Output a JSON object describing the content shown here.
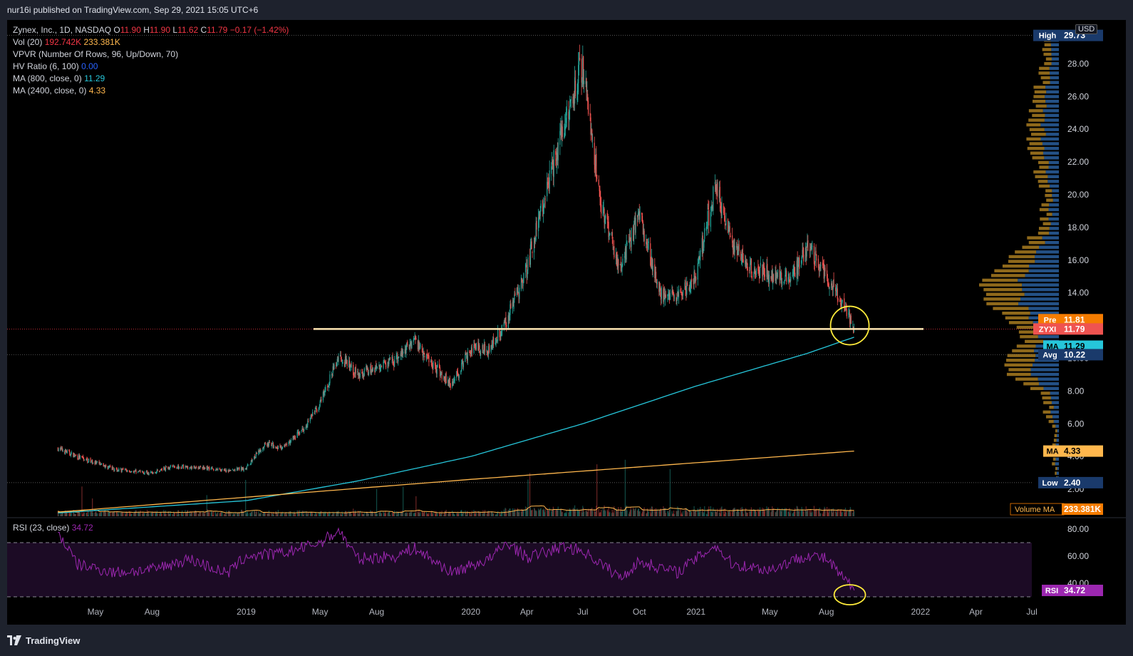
{
  "header": {
    "published": "nur16i published on TradingView.com, Sep 29, 2021 15:05 UTC+6"
  },
  "footer": {
    "brand": "TradingView"
  },
  "legend": {
    "symbol": "Zynex, Inc., 1D, NASDAQ",
    "o_label": "O",
    "o": "11.90",
    "h_label": "H",
    "h": "11.90",
    "l_label": "L",
    "l": "11.62",
    "c_label": "C",
    "c": "11.79",
    "change": "−0.17 (−1.42%)",
    "vol_label": "Vol (20)",
    "vol1": "192.742K",
    "vol2": "233.381K",
    "vpvr": "VPVR (Number Of Rows, 96, Up/Down, 70)",
    "hv_label": "HV Ratio (6, 100)",
    "hv": "0.00",
    "ma800_label": "MA (800, close, 0)",
    "ma800": "11.29",
    "ma2400_label": "MA (2400, close, 0)",
    "ma2400": "4.33"
  },
  "rsi_legend": {
    "label": "RSI (23, close)",
    "value": "34.72"
  },
  "currency": "USD",
  "colors": {
    "up": "#26a69a",
    "down": "#ef5350",
    "ma800": "#26c6da",
    "ma2400": "#ffb74d",
    "rsi": "#9c27b0",
    "support": "#ffe6b3",
    "circle": "#ffeb3b",
    "vpvr_up": "#2a5f9e",
    "vpvr_down": "#a87b20"
  },
  "chart_data": [
    {
      "type": "candlestick",
      "title": "Zynex, Inc., 1D, NASDAQ",
      "xlabel": "",
      "ylabel": "",
      "ylim": [
        0.5,
        30.2
      ],
      "x_ticks": [
        "May",
        "Aug",
        "2019",
        "May",
        "Aug",
        "2020",
        "Apr",
        "Jul",
        "Oct",
        "2021",
        "May",
        "Aug",
        "2022",
        "Apr",
        "Jul"
      ],
      "y_ticks": [
        2,
        4,
        6,
        8,
        10,
        12,
        14,
        16,
        18,
        20,
        22,
        24,
        26,
        28
      ],
      "y_tick_labels": [
        "2.00",
        "4.00",
        "6.00",
        "8.00",
        "10.00",
        "12.00",
        "14.00",
        "16.00",
        "18.00",
        "20.00",
        "22.00",
        "24.00",
        "26.00",
        "28.00"
      ],
      "price_path": [
        {
          "x": "Mar 2018",
          "y": 4.5
        },
        {
          "x": "Apr 2018",
          "y": 4.0
        },
        {
          "x": "May 2018",
          "y": 3.6
        },
        {
          "x": "Jun 2018",
          "y": 3.2
        },
        {
          "x": "Aug 2018",
          "y": 3.0
        },
        {
          "x": "Sep 2018",
          "y": 3.4
        },
        {
          "x": "Nov 2018",
          "y": 3.3
        },
        {
          "x": "Dec 2018",
          "y": 3.1
        },
        {
          "x": "Jan 2019",
          "y": 3.3
        },
        {
          "x": "Feb 2019",
          "y": 4.8
        },
        {
          "x": "Mar 2019",
          "y": 4.5
        },
        {
          "x": "Apr 2019",
          "y": 5.6
        },
        {
          "x": "May 2019",
          "y": 7.2
        },
        {
          "x": "Jun 2019",
          "y": 10.2
        },
        {
          "x": "Jul 2019",
          "y": 9.0
        },
        {
          "x": "Aug 2019",
          "y": 9.5
        },
        {
          "x": "Sep 2019",
          "y": 9.8
        },
        {
          "x": "Oct 2019",
          "y": 11.2
        },
        {
          "x": "Nov 2019",
          "y": 9.6
        },
        {
          "x": "Dec 2019",
          "y": 8.4
        },
        {
          "x": "Jan 2020",
          "y": 10.6
        },
        {
          "x": "Feb 2020",
          "y": 10.6
        },
        {
          "x": "Mar 2020",
          "y": 12.5
        },
        {
          "x": "Apr 2020",
          "y": 15.5
        },
        {
          "x": "May 2020",
          "y": 20.0
        },
        {
          "x": "Jun 2020",
          "y": 24.5
        },
        {
          "x": "Jul 2020",
          "y": 28.0
        },
        {
          "x": "Aug 2020",
          "y": 19.0
        },
        {
          "x": "Sep 2020",
          "y": 15.5
        },
        {
          "x": "Oct 2020",
          "y": 19.0
        },
        {
          "x": "Nov 2020",
          "y": 14.0
        },
        {
          "x": "Dec 2020",
          "y": 13.6
        },
        {
          "x": "Jan 2021",
          "y": 15.0
        },
        {
          "x": "Feb 2021",
          "y": 20.5
        },
        {
          "x": "Mar 2021",
          "y": 17.0
        },
        {
          "x": "Apr 2021",
          "y": 15.4
        },
        {
          "x": "May 2021",
          "y": 15.2
        },
        {
          "x": "Jun 2021",
          "y": 14.8
        },
        {
          "x": "Jul 2021",
          "y": 16.8
        },
        {
          "x": "Aug 2021",
          "y": 15.0
        },
        {
          "x": "Sep 2021",
          "y": 13.0
        },
        {
          "x": "Sep 29 2021",
          "y": 11.79
        }
      ],
      "last": {
        "open": 11.9,
        "high": 11.9,
        "low": 11.62,
        "close": 11.79,
        "change": -0.17,
        "change_pct": -1.42
      },
      "support_level": 11.79,
      "ma800": [
        {
          "x": "Mar 2018",
          "y": 0.55
        },
        {
          "x": "Jan 2019",
          "y": 1.3
        },
        {
          "x": "Jul 2019",
          "y": 2.5
        },
        {
          "x": "Jan 2020",
          "y": 4.0
        },
        {
          "x": "Jul 2020",
          "y": 6.0
        },
        {
          "x": "Jan 2021",
          "y": 8.3
        },
        {
          "x": "Jul 2021",
          "y": 10.3
        },
        {
          "x": "Sep 29 2021",
          "y": 11.29
        }
      ],
      "ma2400": [
        {
          "x": "Mar 2018",
          "y": 0.6
        },
        {
          "x": "Jan 2020",
          "y": 2.6
        },
        {
          "x": "Sep 29 2021",
          "y": 4.33
        }
      ],
      "price_labels": [
        {
          "label": "High",
          "value": "29.73"
        },
        {
          "label": "Pre",
          "value": "11.81"
        },
        {
          "label": "ZYXI",
          "value": "11.79"
        },
        {
          "label": "MA",
          "value": "11.29"
        },
        {
          "label": "Avg",
          "value": "10.22"
        },
        {
          "label": "MA",
          "value": "4.33"
        },
        {
          "label": "Low",
          "value": "2.40"
        },
        {
          "label": "Volume MA",
          "value": "233.381K"
        }
      ]
    },
    {
      "type": "line",
      "title": "RSI (23, close)",
      "ylim": [
        30,
        90
      ],
      "y_ticks": [
        40,
        60,
        80
      ],
      "y_tick_labels": [
        "40.00",
        "60.00",
        "80.00"
      ],
      "bands": [
        30,
        70
      ],
      "series": [
        {
          "name": "RSI",
          "values": [
            {
              "x": "Mar 2018",
              "y": 78
            },
            {
              "x": "Apr 2018",
              "y": 54
            },
            {
              "x": "Jun 2018",
              "y": 48
            },
            {
              "x": "Aug 2018",
              "y": 50
            },
            {
              "x": "Oct 2018",
              "y": 58
            },
            {
              "x": "Dec 2018",
              "y": 47
            },
            {
              "x": "Jan 2019",
              "y": 60
            },
            {
              "x": "Mar 2019",
              "y": 62
            },
            {
              "x": "May 2019",
              "y": 70
            },
            {
              "x": "Jun 2019",
              "y": 79
            },
            {
              "x": "Jul 2019",
              "y": 58
            },
            {
              "x": "Sep 2019",
              "y": 60
            },
            {
              "x": "Oct 2019",
              "y": 66
            },
            {
              "x": "Dec 2019",
              "y": 48
            },
            {
              "x": "Feb 2020",
              "y": 58
            },
            {
              "x": "Mar 2020",
              "y": 70
            },
            {
              "x": "Apr 2020",
              "y": 59
            },
            {
              "x": "Jun 2020",
              "y": 67
            },
            {
              "x": "Jul 2020",
              "y": 64
            },
            {
              "x": "Sep 2020",
              "y": 44
            },
            {
              "x": "Oct 2020",
              "y": 56
            },
            {
              "x": "Dec 2020",
              "y": 48
            },
            {
              "x": "Feb 2021",
              "y": 68
            },
            {
              "x": "Mar 2021",
              "y": 54
            },
            {
              "x": "May 2021",
              "y": 50
            },
            {
              "x": "Jul 2021",
              "y": 61
            },
            {
              "x": "Aug 2021",
              "y": 58
            },
            {
              "x": "Sep 2021",
              "y": 42
            },
            {
              "x": "Sep 29 2021",
              "y": 34.72
            }
          ]
        }
      ]
    }
  ]
}
